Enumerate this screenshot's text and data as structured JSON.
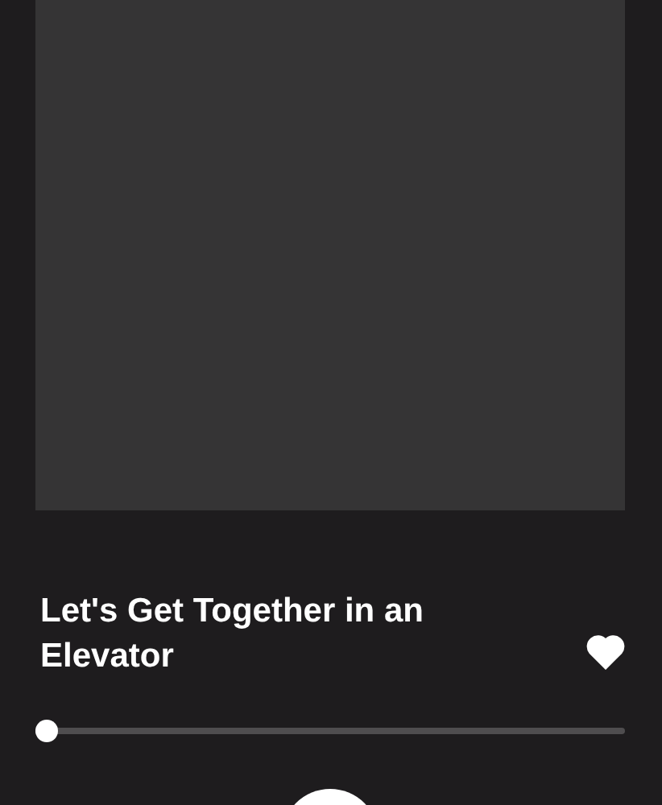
{
  "track": {
    "title": "Let's Get Together in an Elevator",
    "liked": true
  },
  "progress": {
    "level": 0.02
  }
}
